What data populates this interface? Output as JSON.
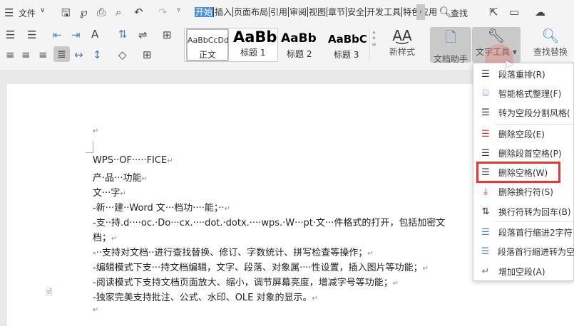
{
  "topbar": {
    "menu_label": "文件",
    "tabs": [
      "开始",
      "插入",
      "页面布局",
      "引用",
      "审阅",
      "视图",
      "章节",
      "安全",
      "开发工具",
      "特色应用"
    ],
    "active_tab": "开始",
    "search_label": "查找"
  },
  "ribbon": {
    "styles": [
      {
        "preview": "AaBbCcDd",
        "name": "正文"
      },
      {
        "preview": "AaBb",
        "name": "标题 1"
      },
      {
        "preview": "AaBb",
        "name": "标题 2"
      },
      {
        "preview": "AaBbC",
        "name": "标题 3"
      }
    ],
    "new_style": "新样式",
    "doc_helper": "文档助手",
    "text_tools": "文字工具",
    "find_replace": "查找替换"
  },
  "document": {
    "lines": [
      "WPS··OF·····FICE",
      "产·品···功能",
      "文···字",
      "-新···建··Word 文···档功····能；··",
      "-支··持.d····oc.·Do···cx.····dot.·dotx.····wps.·W···pt·文···件格式的打开，包括加密文",
      "档；",
      "-··支持对文档··进行查找替换、修订、字数统计、拼写检查等操作；",
      "-编辑模式下支···持文档编辑，文字、段落、对象属····性设置，插入图片等功能；",
      "-阅读模式下支持文档页面放大、缩小，调节屏幕亮度，增减字号等功能；",
      "-独家完美支持批注、公式、水印、OLE 对象的显示。"
    ]
  },
  "menu": {
    "items": [
      {
        "label": "段落重排(R)",
        "icon": "paragraph-rearrange-icon"
      },
      {
        "label": "智能格式整理(F)",
        "icon": "smart-format-icon"
      },
      {
        "label": "转为空段分割风格(",
        "icon": "split-style-icon"
      },
      {
        "label": "删除空段(E)",
        "icon": "delete-empty-para-icon"
      },
      {
        "label": "删除段首空格(P)",
        "icon": "delete-leading-space-icon"
      },
      {
        "label": "删除空格(W)",
        "icon": "delete-space-icon"
      },
      {
        "label": "删除换行符(S)",
        "icon": "delete-linebreak-icon"
      },
      {
        "label": "换行符转为回车(B)",
        "icon": "linebreak-to-enter-icon"
      },
      {
        "label": "段落首行缩进2字符",
        "icon": "indent-2-icon"
      },
      {
        "label": "段落首行缩进转为空",
        "icon": "indent-to-space-icon"
      },
      {
        "label": "增加空段(A)",
        "icon": "add-empty-para-icon"
      }
    ],
    "highlighted": "删除空格(W)"
  }
}
